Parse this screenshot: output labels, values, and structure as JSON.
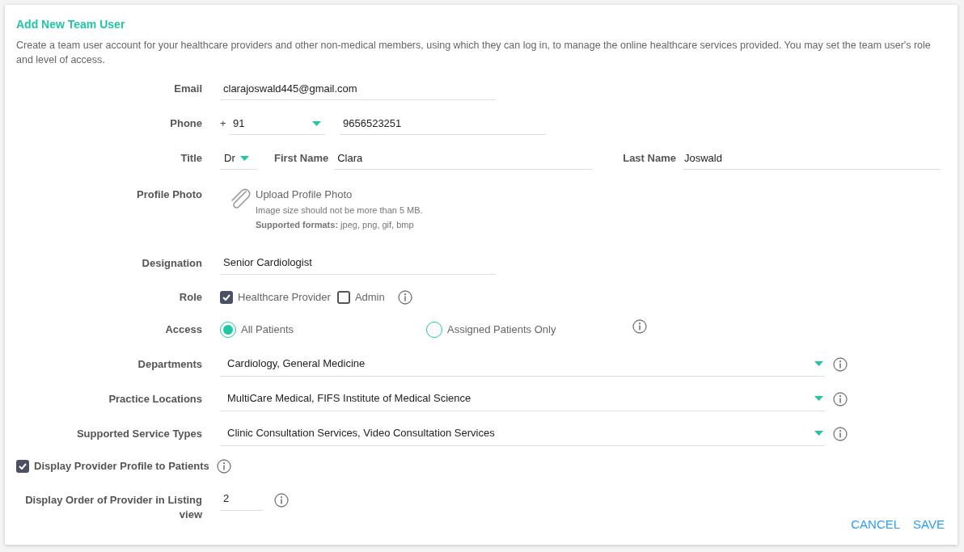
{
  "title": "Add New Team User",
  "description": "Create a team user account for your healthcare providers and other non-medical members, using which they can log in, to manage the online healthcare services provided. You may set the team user's role and level of access.",
  "email": {
    "label": "Email",
    "value": "clarajoswald445@gmail.com"
  },
  "phone": {
    "label": "Phone",
    "plus": "+",
    "country_code": "91",
    "number": "9656523251"
  },
  "name": {
    "label": "Title",
    "title": "Dr",
    "first_name_label": "First Name",
    "first_name": "Clara",
    "last_name_label": "Last Name",
    "last_name": "Joswald"
  },
  "profile_photo": {
    "label": "Profile Photo",
    "upload": "Upload Profile Photo",
    "size_note": "Image size should not be more than 5 MB.",
    "formats_note": "**Supported formats:** jpeg, png, gif, bmp"
  },
  "designation": {
    "label": "Designation",
    "value": "Senior Cardiologist"
  },
  "role": {
    "label": "Role",
    "options": [
      {
        "label": "Healthcare Provider",
        "checked": true
      },
      {
        "label": "Admin",
        "checked": false
      }
    ]
  },
  "access": {
    "label": "Access",
    "options": [
      {
        "label": "All Patients",
        "selected": true
      },
      {
        "label": "Assigned Patients Only",
        "selected": false
      }
    ]
  },
  "multi_selects": [
    {
      "label": "Departments",
      "value": "Cardiology, General Medicine"
    },
    {
      "label": "Practice Locations",
      "value": "MultiCare Medical, FIFS Institute of Medical Science"
    },
    {
      "label": "Supported Service Types",
      "value": "Clinic Consultation Services, Video Consultation Services"
    }
  ],
  "display_profile": {
    "label": "Display Provider Profile to Patients",
    "checked": true
  },
  "display_order": {
    "label": "Display Order of Provider in Listing view",
    "value": "2"
  },
  "buttons": [
    "CANCEL",
    "SAVE"
  ]
}
